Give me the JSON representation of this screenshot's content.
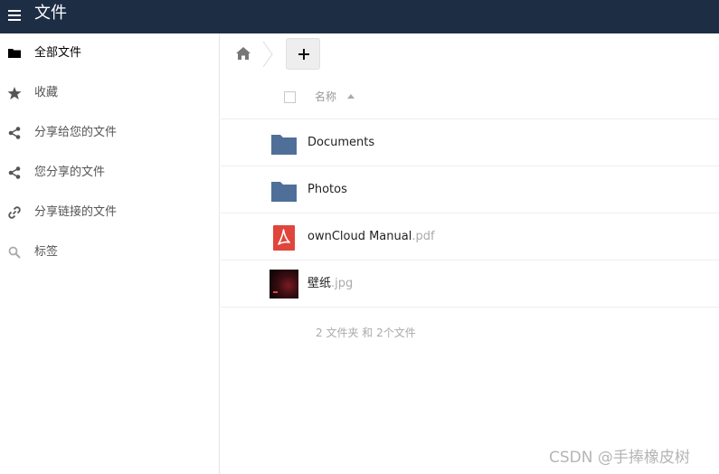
{
  "header": {
    "title": "文件",
    "menu_icon": "hamburger-icon"
  },
  "sidebar": {
    "items": [
      {
        "label": "全部文件",
        "icon": "folder-icon",
        "active": true
      },
      {
        "label": "收藏",
        "icon": "star-icon",
        "active": false
      },
      {
        "label": "分享给您的文件",
        "icon": "share-icon",
        "active": false
      },
      {
        "label": "您分享的文件",
        "icon": "share-icon",
        "active": false
      },
      {
        "label": "分享链接的文件",
        "icon": "link-icon",
        "active": false
      },
      {
        "label": "标签",
        "icon": "tag-search-icon",
        "active": false
      }
    ]
  },
  "toolbar": {
    "home_icon": "home-icon",
    "add_label": "+"
  },
  "file_list": {
    "column_name": "名称",
    "sort_direction": "ascending",
    "files": [
      {
        "name": "Documents",
        "ext": "",
        "type": "folder",
        "icon": "folder-icon"
      },
      {
        "name": "Photos",
        "ext": "",
        "type": "folder",
        "icon": "folder-icon"
      },
      {
        "name": "ownCloud Manual",
        "ext": ".pdf",
        "type": "pdf",
        "icon": "pdf-icon"
      },
      {
        "name": "壁纸",
        "ext": ".jpg",
        "type": "image",
        "icon": "image-thumbnail"
      }
    ],
    "summary": "2 文件夹 和 2个文件"
  },
  "watermark": "CSDN @手捧橡皮树",
  "colors": {
    "topbar": "#1d2d44",
    "folder": "#4f6f98",
    "pdf": "#e0453c",
    "muted_text": "#aaaaaa"
  }
}
